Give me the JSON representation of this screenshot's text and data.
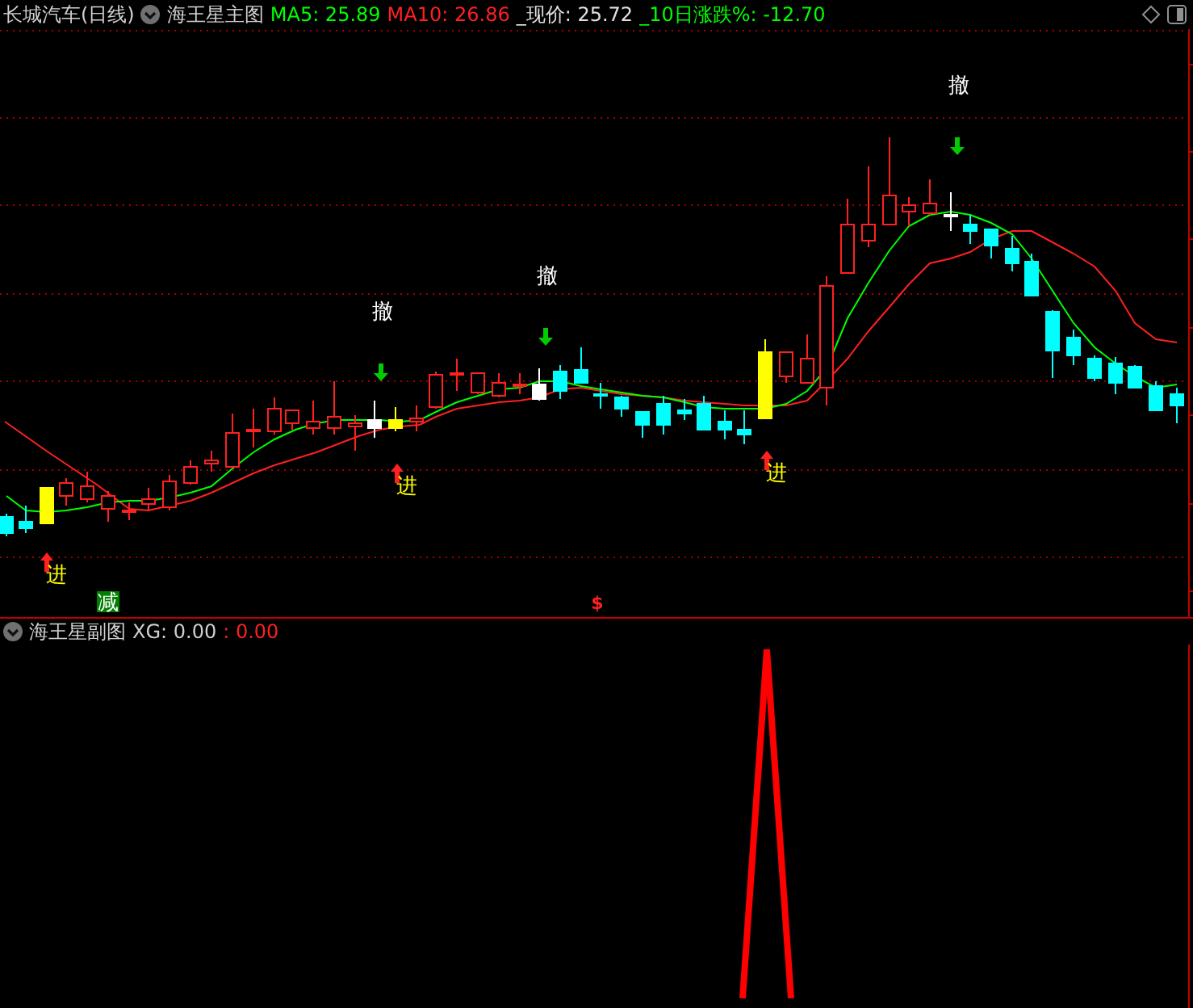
{
  "header": {
    "title": "长城汽车(日线)",
    "indicator": "海王星主图",
    "values": [
      {
        "text": "MA5: 25.89",
        "color": "#00ff00"
      },
      {
        "text": "MA10: 26.86",
        "color": "#ff2020"
      },
      {
        "text": "_现价: 25.72",
        "color": "#e0e0e0"
      },
      {
        "text": "_10日涨跌%: -12.70",
        "color": "#00ff00"
      }
    ]
  },
  "main_chart": {
    "signals": [
      {
        "kind": "enter",
        "text": "进"
      },
      {
        "kind": "reduce",
        "text": "减"
      },
      {
        "kind": "exit",
        "text": "撤"
      },
      {
        "kind": "enter",
        "text": "进"
      },
      {
        "kind": "exit",
        "text": "撤"
      },
      {
        "kind": "dollar",
        "text": "$"
      },
      {
        "kind": "enter",
        "text": "进"
      },
      {
        "kind": "exit",
        "text": "撤"
      }
    ]
  },
  "sub_chart": {
    "indicator": "海王星副图",
    "values": [
      {
        "text": "XG: 0.00",
        "color": "#d0d0d0"
      },
      {
        "text": ": 0.00",
        "color": "#ff2020"
      }
    ]
  }
}
